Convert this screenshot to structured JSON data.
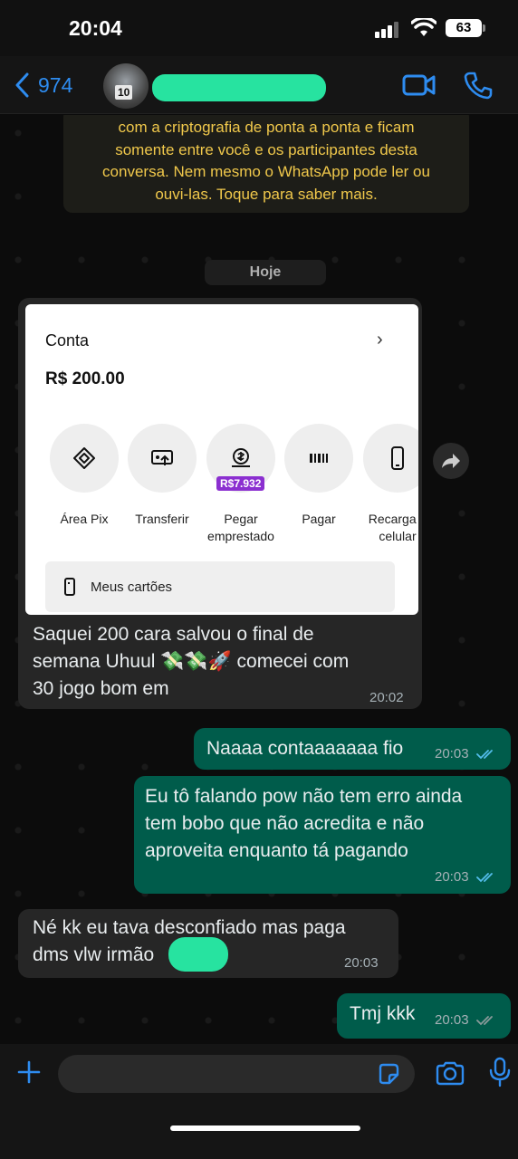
{
  "status_bar": {
    "time": "20:04",
    "battery": "63"
  },
  "header": {
    "back_count": "974"
  },
  "encryption_notice": {
    "lines": [
      "com a criptografia de ponta a ponta e ficam",
      "somente entre você e os participantes desta",
      "conversa. Nem mesmo o WhatsApp pode ler ou",
      "ouvi-las. Toque para saber mais."
    ]
  },
  "date_separator": "Hoje",
  "avatar_jersey_number": "10",
  "shared_screenshot": {
    "title": "Conta",
    "balance": "R$ 200.00",
    "actions": [
      {
        "label": "Área Pix",
        "icon": "pix-icon"
      },
      {
        "label": "Transferir",
        "icon": "transfer-icon"
      },
      {
        "label": "Pegar\nemprestado",
        "icon": "loan-icon",
        "badge": "R$7.932"
      },
      {
        "label": "Pagar",
        "icon": "barcode-icon"
      },
      {
        "label": "Recarga d\ncelular",
        "icon": "phone-icon"
      }
    ],
    "cards_label": "Meus cartões"
  },
  "messages": [
    {
      "direction": "in",
      "text_line1": "Saquei 200 cara salvou o final de",
      "text_line2": "semana Uhuul 💸💸🚀 comecei com",
      "text_line3": "30 jogo bom em",
      "time": "20:02"
    },
    {
      "direction": "out",
      "text": "Naaaa contaaaaaaa fio",
      "time": "20:03"
    },
    {
      "direction": "out",
      "text_line1": "Eu tô falando pow não tem erro ainda",
      "text_line2": "tem bobo que não acredita e não",
      "text_line3": "aproveita enquanto tá pagando",
      "time": "20:03"
    },
    {
      "direction": "in",
      "text_line1": "Né kk eu tava desconfiado mas paga",
      "text_line2": "dms vlw irmão",
      "time": "20:03"
    },
    {
      "direction": "out",
      "text": "Tmj kkk",
      "time": "20:03"
    }
  ],
  "colors": {
    "accent_blue": "#2e8cf0",
    "outgoing_bubble": "#005c4b",
    "incoming_bubble": "#262626",
    "encryption_text": "#f0c84b",
    "redaction_green": "#27e3a0",
    "read_ticks": "#53bdeb"
  }
}
